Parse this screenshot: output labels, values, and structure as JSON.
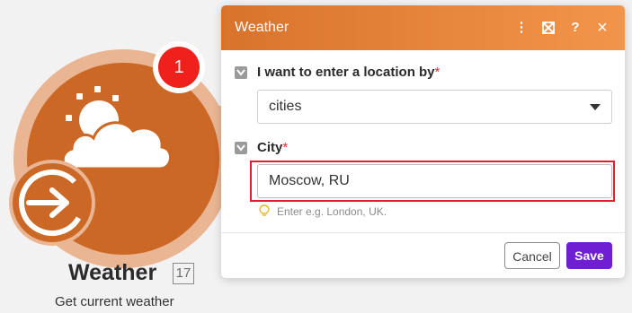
{
  "node": {
    "title": "Weather",
    "id": "17",
    "subtitle": "Get current weather",
    "badge_count": "1",
    "icon": "weather-cloud-sun-icon",
    "trigger_icon": "arrow-circle-right-icon",
    "brand_color": "#cc6826"
  },
  "dialog": {
    "title": "Weather",
    "header_icons": [
      "kebab-menu-icon",
      "expand-icon",
      "help-icon",
      "close-icon"
    ],
    "header_glyphs": {
      "menu": "⋮",
      "help": "?",
      "close": "×"
    },
    "location_field": {
      "label": "I want to enter a location by",
      "required_mark": "*",
      "value": "cities"
    },
    "city_field": {
      "label": "City",
      "required_mark": "*",
      "value": "Moscow, RU",
      "hint": "Enter e.g. London, UK."
    },
    "buttons": {
      "cancel": "Cancel",
      "save": "Save"
    },
    "accent_color": "#6f1fd1",
    "highlight_color": "#e2202d"
  }
}
